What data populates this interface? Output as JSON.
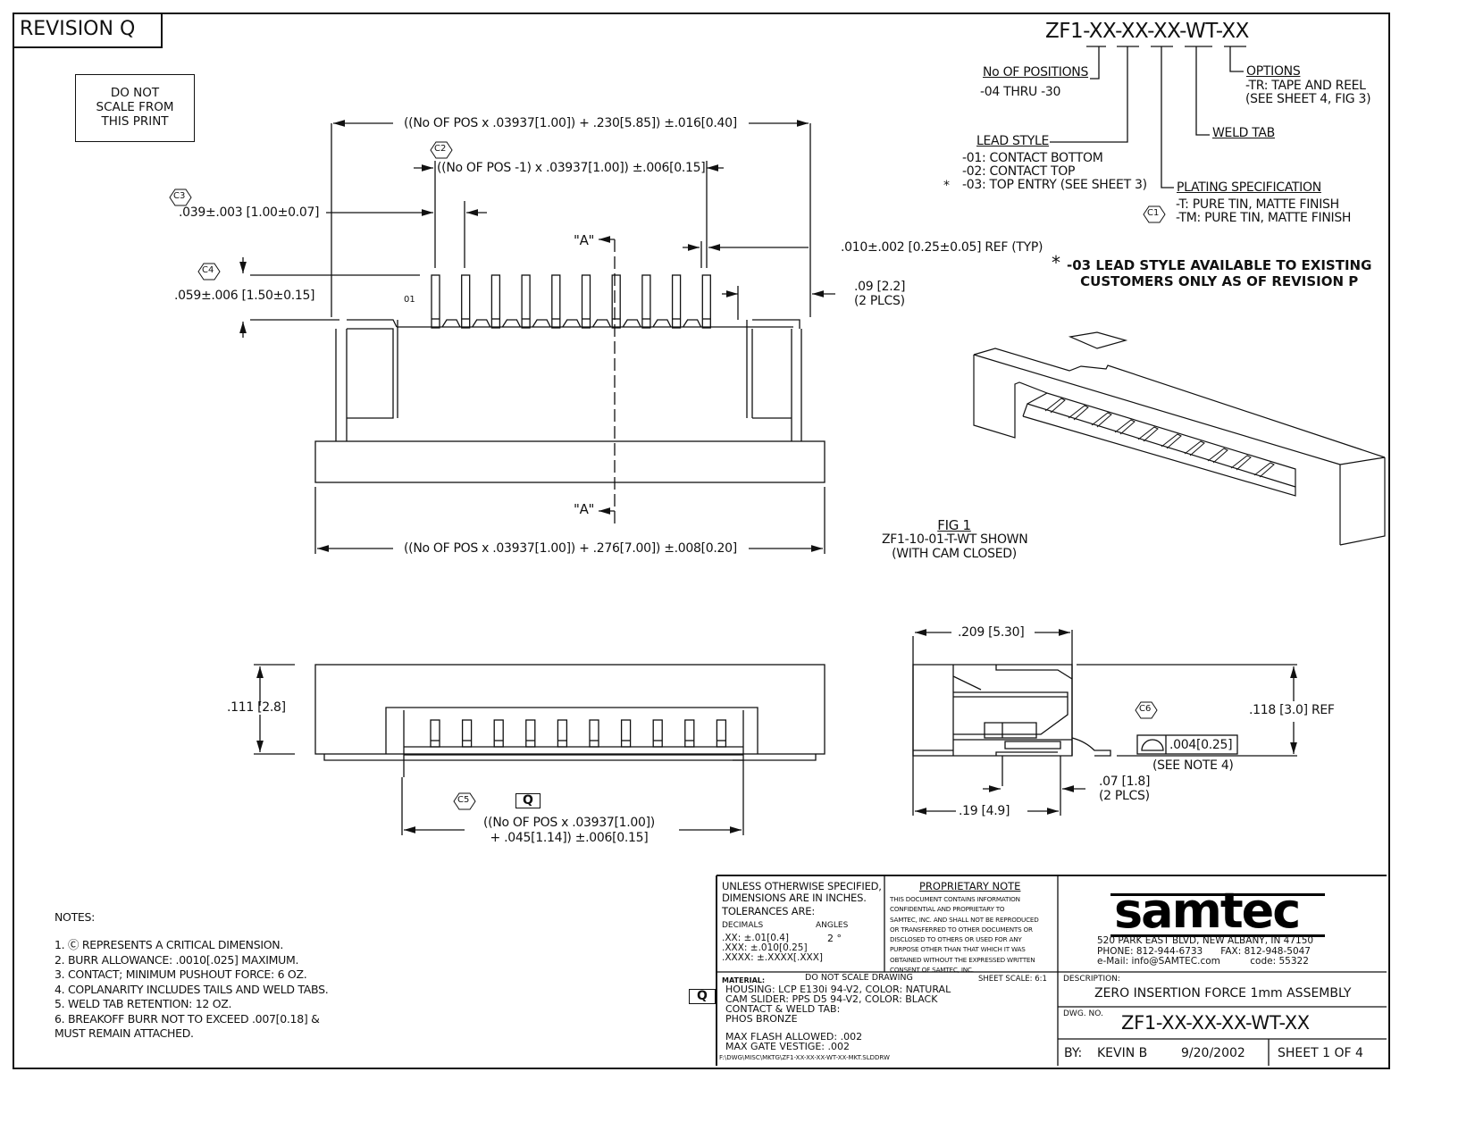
{
  "revision": "REVISION Q",
  "do_not_scale": [
    "DO NOT",
    "SCALE FROM",
    "THIS PRINT"
  ],
  "part_number": {
    "code": "ZF1-XX-XX-XX-WT-XX",
    "positions": {
      "label": "No OF POSITIONS",
      "value": "-04 THRU -30"
    },
    "lead_style": {
      "label": "LEAD STYLE",
      "items": [
        "-01: CONTACT BOTTOM",
        "-02: CONTACT TOP",
        "-03: TOP ENTRY (SEE SHEET 3)"
      ],
      "asterisk": "*"
    },
    "plating": {
      "label": "PLATING SPECIFICATION",
      "items": [
        "-T: PURE TIN, MATTE FINISH",
        "-TM: PURE TIN, MATTE FINISH"
      ],
      "critical": "C1"
    },
    "weld_tab": {
      "label": "WELD TAB"
    },
    "options": {
      "label": "OPTIONS",
      "items": [
        "-TR: TAPE AND REEL",
        "(SEE SHEET 4, FIG 3)"
      ]
    }
  },
  "lead_notice": [
    "-03 LEAD STYLE AVAILABLE TO EXISTING",
    "CUSTOMERS ONLY AS OF REVISION P"
  ],
  "lead_notice_asterisk": "*",
  "top_view": {
    "overall_dim": "((No OF POS x .03937[1.00]) + .230[5.85]) ±.016[0.40]",
    "pitch_span_dim": "((No OF POS -1) x .03937[1.00]) ±.006[0.15]",
    "pitch_critical": "C2",
    "pitch_dim": ".039±.003 [1.00±0.07]",
    "pitch_critical_c3": "C3",
    "height_dim": ".059±.006 [1.50±0.15]",
    "height_critical": "C4",
    "contact_width_dim": ".010±.002 [0.25±0.05]  REF (TYP)",
    "weld_dim": [
      ".09 [2.2]",
      "(2 PLCS)"
    ],
    "pin_label": "01",
    "section_marker": "\"A\"",
    "base_dim": "((No OF POS x .03937[1.00]) + .276[7.00]) ±.008[0.20]",
    "contact_count": 10
  },
  "fig1": {
    "title": "FIG 1",
    "lines": [
      "ZF1-10-01-T-WT SHOWN",
      "(WITH CAM CLOSED)"
    ]
  },
  "front_view": {
    "height_dim": ".111 [2.8]",
    "critical": "C5",
    "rev_flag": "Q",
    "width_dim": [
      "((No OF POS x .03937[1.00])",
      "+ .045[1.14]) ±.006[0.15]"
    ]
  },
  "side_view": {
    "width_dim": ".209 [5.30]",
    "height_dim": ".118 [3.0]  REF",
    "critical": "C6",
    "profile_tol": ".004[0.25]",
    "see_note": "(SEE NOTE 4)",
    "tab_dim": [
      ".07 [1.8]",
      "(2 PLCS)"
    ],
    "base_dim": ".19 [4.9]"
  },
  "notes": {
    "title": "NOTES:",
    "items": [
      "1.  Ⓒ  REPRESENTS A CRITICAL DIMENSION.",
      "2. BURR ALLOWANCE: .0010[.025] MAXIMUM.",
      "3. CONTACT; MINIMUM PUSHOUT FORCE:  6 OZ.",
      "4. COPLANARITY INCLUDES TAILS AND WELD TABS.",
      "5. WELD TAB RETENTION: 12 OZ.",
      "6. BREAKOFF BURR NOT TO EXCEED .007[0.18] &",
      "    MUST REMAIN ATTACHED."
    ]
  },
  "title_block": {
    "tolerances": {
      "lines": [
        "UNLESS  OTHERWISE  SPECIFIED,",
        "DIMENSIONS ARE IN INCHES.",
        "TOLERANCES  ARE:"
      ],
      "decimals_label": "DECIMALS",
      "angles_label": "ANGLES",
      "decimals": [
        ".XX:  ±.01[0.4]",
        ".XXX:  ±.010[0.25]",
        ".XXXX:  ±.XXXX[.XXX]"
      ],
      "angles": "2 °"
    },
    "proprietary": {
      "title": "PROPRIETARY NOTE",
      "text": [
        "THIS DOCUMENT CONTAINS INFORMATION",
        "CONFIDENTIAL AND PROPRIETARY TO",
        "SAMTEC, INC. AND SHALL NOT BE REPRODUCED",
        "OR TRANSFERRED TO OTHER DOCUMENTS OR",
        "DISCLOSED TO OTHERS OR USED FOR ANY",
        "PURPOSE OTHER THAN THAT WHICH IT WAS",
        "OBTAINED WITHOUT THE EXPRESSED WRITTEN",
        "CONSENT OF SAMTEC, INC."
      ]
    },
    "company": {
      "logo": "samtec",
      "address": "520 PARK EAST BLVD, NEW ALBANY, IN 47150",
      "phone": "PHONE: 812-944-6733",
      "fax": "FAX: 812-948-5047",
      "email": "e-Mail: info@SAMTEC.com",
      "code": "code: 55322"
    },
    "material": {
      "label": "MATERIAL:",
      "do_not_scale": "DO  NOT  SCALE  DRAWING",
      "sheet_scale": "SHEET SCALE: 6:1",
      "lines": [
        "HOUSING: LCP E130i 94-V2, COLOR: NATURAL",
        "CAM SLIDER: PPS D5 94-V2, COLOR: BLACK",
        "CONTACT & WELD TAB:",
        "  PHOS BRONZE",
        "",
        "MAX FLASH ALLOWED: .002",
        "MAX GATE VESTIGE: .002"
      ],
      "file_path": "F:\\DWG\\MISC\\MKTG\\ZF1-XX-XX-XX-WT-XX-MKT.SLDDRW",
      "rev_flag": "Q"
    },
    "description_label": "DESCRIPTION:",
    "description": "ZERO INSERTION FORCE 1mm ASSEMBLY",
    "dwg_no_label": "DWG.  NO.",
    "dwg_no": "ZF1-XX-XX-XX-WT-XX",
    "by_label": "BY:",
    "by": "KEVIN B",
    "date": "9/20/2002",
    "sheet": "SHEET 1  OF  4"
  }
}
